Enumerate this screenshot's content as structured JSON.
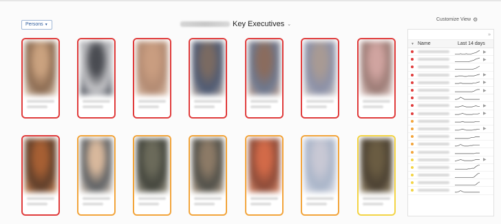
{
  "header": {
    "filter_label": "Persons",
    "title": "Key Executives",
    "customize_label": "Customize View"
  },
  "icons": {
    "filter_caret": "chevron-down-icon",
    "title_caret": "chevron-down-icon",
    "customize": "gear-icon",
    "sort": "sort-down-icon",
    "row_action": "play-icon"
  },
  "colors": {
    "red": "#e03b3b",
    "orange": "#f2a43a",
    "yellow": "#f3d444",
    "link": "#2f5c9c"
  },
  "cards": [
    {
      "status": "red",
      "tone": [
        "#caa27f",
        "#8a6a51",
        "#e8d4c0"
      ]
    },
    {
      "status": "red",
      "tone": [
        "#4a4c52",
        "#c9c9cc",
        "#2f3440"
      ]
    },
    {
      "status": "red",
      "tone": [
        "#c99d80",
        "#b28a72",
        "#e0c4b0"
      ]
    },
    {
      "status": "red",
      "tone": [
        "#7a6a62",
        "#4d5a74",
        "#c8b8ae"
      ]
    },
    {
      "status": "red",
      "tone": [
        "#8a6c5e",
        "#6c7890",
        "#c9a896"
      ]
    },
    {
      "status": "red",
      "tone": [
        "#a89a94",
        "#8a90a8",
        "#d4ccc8"
      ]
    },
    {
      "status": "red",
      "tone": [
        "#d0a4a0",
        "#9a7a74",
        "#ead6d2"
      ]
    },
    {
      "status": "red",
      "tone": [
        "#a65f33",
        "#5c3d2a",
        "#d98f5c"
      ]
    },
    {
      "status": "orange",
      "tone": [
        "#d8b89c",
        "#5a5e62",
        "#e8d8c8"
      ]
    },
    {
      "status": "orange",
      "tone": [
        "#6b6a5a",
        "#42443c",
        "#b0aa98"
      ]
    },
    {
      "status": "orange",
      "tone": [
        "#8c7a66",
        "#4e4e48",
        "#c6b29c"
      ]
    },
    {
      "status": "orange",
      "tone": [
        "#d26a48",
        "#8a4a38",
        "#e89a78"
      ]
    },
    {
      "status": "orange",
      "tone": [
        "#c8c8d4",
        "#a8b4c8",
        "#e4e4ec"
      ]
    },
    {
      "status": "yellow",
      "tone": [
        "#6a5c42",
        "#4a4032",
        "#a89878"
      ]
    }
  ],
  "panel": {
    "col_name": "Name",
    "col_days": "Last 14 days",
    "rows": [
      {
        "status": "red",
        "spark": [
          1,
          1,
          1,
          2,
          1,
          1,
          2,
          1,
          1,
          2,
          3,
          4,
          6,
          8
        ],
        "action": true
      },
      {
        "status": "red",
        "spark": [
          1,
          1,
          1,
          1,
          1,
          1,
          1,
          1,
          2,
          3,
          4,
          6,
          7,
          8
        ],
        "action": true
      },
      {
        "status": "red",
        "spark": [
          1,
          1,
          1,
          1,
          1,
          1,
          1,
          1,
          1,
          1,
          2,
          3,
          5,
          7
        ],
        "action": false
      },
      {
        "status": "red",
        "spark": [
          2,
          2,
          3,
          3,
          3,
          2,
          2,
          3,
          3,
          3,
          3,
          4,
          5,
          6
        ],
        "action": true
      },
      {
        "status": "red",
        "spark": [
          3,
          3,
          3,
          4,
          3,
          3,
          3,
          3,
          3,
          3,
          4,
          4,
          5,
          6
        ],
        "action": true
      },
      {
        "status": "red",
        "spark": [
          3,
          3,
          3,
          3,
          3,
          3,
          3,
          3,
          3,
          3,
          4,
          6,
          7,
          7
        ],
        "action": true
      },
      {
        "status": "red",
        "spark": [
          3,
          3,
          4,
          7,
          5,
          3,
          3,
          3,
          3,
          3,
          3,
          3,
          3,
          3
        ],
        "action": false
      },
      {
        "status": "red",
        "spark": [
          3,
          3,
          3,
          4,
          5,
          4,
          3,
          3,
          3,
          3,
          4,
          5,
          4,
          4
        ],
        "action": true
      },
      {
        "status": "red",
        "spark": [
          3,
          3,
          3,
          4,
          5,
          4,
          3,
          3,
          3,
          3,
          4,
          4,
          4,
          5
        ],
        "action": true
      },
      {
        "status": "orange",
        "spark": [
          3,
          3,
          3,
          3,
          4,
          3,
          3,
          3,
          3,
          3,
          3,
          4,
          4,
          4
        ],
        "action": false
      },
      {
        "status": "orange",
        "spark": [
          2,
          2,
          2,
          3,
          4,
          3,
          2,
          2,
          2,
          2,
          3,
          3,
          4,
          4
        ],
        "action": true
      },
      {
        "status": "orange",
        "spark": [
          2,
          2,
          2,
          2,
          2,
          2,
          2,
          2,
          3,
          4,
          4,
          5,
          5,
          5
        ],
        "action": false
      },
      {
        "status": "orange",
        "spark": [
          2,
          2,
          3,
          5,
          3,
          2,
          2,
          2,
          3,
          3,
          4,
          4,
          4,
          4
        ],
        "action": false
      },
      {
        "status": "orange",
        "spark": [
          2,
          2,
          2,
          2,
          2,
          2,
          2,
          2,
          2,
          2,
          2,
          3,
          3,
          3
        ],
        "action": false
      },
      {
        "status": "yellow",
        "spark": [
          2,
          3,
          4,
          5,
          4,
          3,
          3,
          3,
          3,
          3,
          4,
          5,
          5,
          5
        ],
        "action": true
      },
      {
        "status": "yellow",
        "spark": [
          1,
          1,
          1,
          1,
          1,
          1,
          1,
          2,
          2,
          3,
          3,
          6,
          8,
          9
        ],
        "action": false
      },
      {
        "status": "yellow",
        "spark": [
          1,
          1,
          1,
          1,
          1,
          1,
          1,
          1,
          1,
          1,
          2,
          5,
          8,
          9
        ],
        "action": false
      },
      {
        "status": "yellow",
        "spark": [
          1,
          1,
          1,
          1,
          1,
          1,
          1,
          1,
          1,
          1,
          1,
          2,
          5,
          7
        ],
        "action": false
      },
      {
        "status": "yellow",
        "spark": [
          2,
          2,
          3,
          5,
          3,
          2,
          2,
          2,
          2,
          2,
          2,
          2,
          2,
          2
        ],
        "action": false
      }
    ]
  }
}
